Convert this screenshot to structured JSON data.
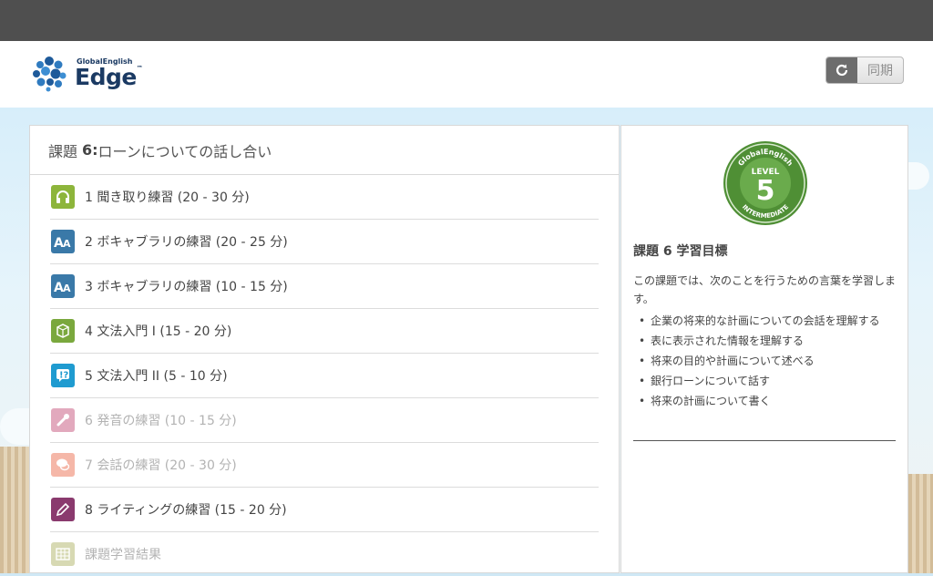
{
  "header": {
    "logo_small": "GlobalEnglish",
    "logo_main": "Edge",
    "logo_tm": "™",
    "sync_label": "同期",
    "sync_icon": "refresh-icon"
  },
  "task": {
    "prefix": "課題",
    "number_label": "6:",
    "name": "ローンについての話し合い"
  },
  "activities": [
    {
      "label": "1 聞き取り練習 (20 - 30 分)",
      "icon": "headphones-icon",
      "color": "#8db53b",
      "enabled": true
    },
    {
      "label": "2 ボキャブラリの練習 (20 - 25 分)",
      "icon": "vocabulary-icon",
      "color": "#3a79a8",
      "enabled": true
    },
    {
      "label": "3 ボキャブラリの練習 (10 - 15 分)",
      "icon": "vocabulary-icon",
      "color": "#3a79a8",
      "enabled": true
    },
    {
      "label": "4 文法入門 I (15 - 20 分)",
      "icon": "grammar-cube-icon",
      "color": "#7aa83d",
      "enabled": true
    },
    {
      "label": "5 文法入門 II (5 - 10 分)",
      "icon": "grammar-question-icon",
      "color": "#1f9bd0",
      "enabled": true
    },
    {
      "label": "6 発音の練習 (10 - 15 分)",
      "icon": "pronunciation-icon",
      "color": "#e2a9bd",
      "enabled": false
    },
    {
      "label": "7 会話の練習 (20 - 30 分)",
      "icon": "conversation-icon",
      "color": "#f5b7a8",
      "enabled": false
    },
    {
      "label": "8 ライティングの練習 (15 - 20 分)",
      "icon": "pencil-icon",
      "color": "#8a3a6e",
      "enabled": true
    },
    {
      "label": "課題学習結果",
      "icon": "results-grid-icon",
      "color": "#d7d9b3",
      "enabled": false
    }
  ],
  "level_badge": {
    "top_text": "GlobalEnglish",
    "level_word": "LEVEL",
    "level_number": "5",
    "bottom_text": "INTERMEDIATE",
    "color": "#5a9a3e"
  },
  "goals": {
    "title": "課題 6 学習目標",
    "intro": "この課題では、次のことを行うための言葉を学習します。",
    "items": [
      "企業の将来的な計画についての会話を理解する",
      "表に表示された情報を理解する",
      "将来の目的や計画について述べる",
      "銀行ローンについて話す",
      "将来の計画について書く"
    ]
  }
}
